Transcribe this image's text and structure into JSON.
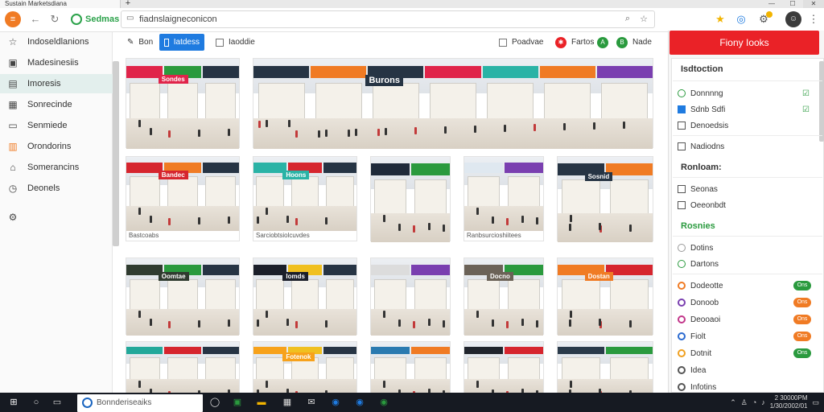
{
  "browser": {
    "tab_title": "Sustain Marketsdiana",
    "new_tab": "+",
    "window_controls": [
      "—",
      "☐",
      "✕"
    ],
    "brand_name": "Sedmas",
    "url": "fiadnslaigneconicon",
    "back_icon": "arrow-left",
    "forward_icon": "arrow-right",
    "reload_icon": "reload"
  },
  "sidebar": {
    "items": [
      {
        "label": "Indoseldlanions",
        "icon": "star"
      },
      {
        "label": "Madesinesiis",
        "icon": "image"
      },
      {
        "label": "Imoresis",
        "icon": "folder"
      },
      {
        "label": "Sonrecinde",
        "icon": "calendar"
      },
      {
        "label": "Senmiede",
        "icon": "document"
      },
      {
        "label": "Orondorins",
        "icon": "clipboard"
      },
      {
        "label": "Somerancins",
        "icon": "building"
      },
      {
        "label": "Deonels",
        "icon": "clock"
      },
      {
        "label": "",
        "icon": "gear"
      }
    ],
    "active_index": 2
  },
  "toolbar": {
    "view_label": "Bon",
    "tab_active_label": "Iatdess",
    "tab_label": "Iaoddie",
    "filter_label": "Poadvae",
    "sort_label": "Fartos",
    "badge_a": "A",
    "badge_b": "B",
    "share_label": "Nade"
  },
  "grid": {
    "tiles": [
      {
        "caption": "",
        "sign": "Sondes",
        "sign_color": "#e0244a",
        "accent": "#2a9a3e"
      },
      {
        "caption": "",
        "sign": "Burons",
        "sign_color": "#263444",
        "accent": "#f07b24"
      },
      {
        "caption": "Bastcoabs",
        "sign": "Bandec",
        "sign_color": "#d6252e",
        "accent": "#f07b24"
      },
      {
        "caption": "Sarciobtsiolcuvdes",
        "sign": "Hoons",
        "sign_color": "#2ab3a6",
        "accent": "#d6252e"
      },
      {
        "caption": "",
        "sign": "",
        "sign_color": "#1f2a3a",
        "accent": "#2a9a3e"
      },
      {
        "caption": "Ranbsurcioshiitees",
        "sign": "",
        "sign_color": "#dfe8f0",
        "accent": "#7a3fb0"
      },
      {
        "caption": "",
        "sign": "Sosnid",
        "sign_color": "#263444",
        "accent": "#f07b24"
      },
      {
        "caption": "",
        "sign": "Oomtae",
        "sign_color": "#2f3b2f",
        "accent": "#2a9a3e"
      },
      {
        "caption": "",
        "sign": "Iomds",
        "sign_color": "#1b1f2a",
        "accent": "#f0c020"
      },
      {
        "caption": "",
        "sign": "",
        "sign_color": "#dcdcdc",
        "accent": "#7a3fb0"
      },
      {
        "caption": "",
        "sign": "Docno",
        "sign_color": "#6b6257",
        "accent": "#2a9a3e"
      },
      {
        "caption": "",
        "sign": "Dostan",
        "sign_color": "#f07b24",
        "accent": "#d6252e"
      },
      {
        "caption": "",
        "sign": "",
        "sign_color": "#22a89a",
        "accent": "#d6252e"
      },
      {
        "caption": "",
        "sign": "Fotenok",
        "sign_color": "#f7a21b",
        "accent": "#f0c020"
      },
      {
        "caption": "",
        "sign": "",
        "sign_color": "#2a7ab0",
        "accent": "#f07b24"
      },
      {
        "caption": "",
        "sign": "",
        "sign_color": "#20242c",
        "accent": "#d6252e"
      },
      {
        "caption": "",
        "sign": "",
        "sign_color": "#2a3a4a",
        "accent": "#2a9a3e"
      }
    ]
  },
  "right_panel": {
    "button": "Fiony Iooks",
    "section1_title": "Isdtoction",
    "section1_items": [
      "Donnnng",
      "Sdnb Sdfi",
      "Denoedsis",
      "Nadiodns"
    ],
    "section2_title": "Ronloam:",
    "section2_items": [
      "Seonas",
      "Oeeonbdt"
    ],
    "section3_title": "Rosnies",
    "section3_items": [
      "Dotins",
      "Dartons"
    ],
    "section4_items": [
      {
        "label": "Dodeotte",
        "tag": "Ons",
        "tag_color": "#2a9a3e",
        "icon_color": "#f07b24"
      },
      {
        "label": "Donoob",
        "tag": "Ons",
        "tag_color": "#f07b24",
        "icon_color": "#7a3fb0"
      },
      {
        "label": "Deooaoi",
        "tag": "Ons",
        "tag_color": "#f07b24",
        "icon_color": "#c2368a"
      },
      {
        "label": "Fiolt",
        "tag": "Ons",
        "tag_color": "#f07b24",
        "icon_color": "#2a6ad0"
      },
      {
        "label": "Dotnit",
        "tag": "Ons",
        "tag_color": "#2a9a3e",
        "icon_color": "#f0a020"
      },
      {
        "label": "Idea",
        "tag": "",
        "tag_color": "",
        "icon_color": "#555555"
      },
      {
        "label": "Infotins",
        "tag": "",
        "tag_color": "",
        "icon_color": "#555555"
      }
    ]
  },
  "taskbar": {
    "search_text": "Bonnderiseaiks",
    "clock_time": "2 30000PM",
    "clock_date": "1/30/2002/01"
  }
}
